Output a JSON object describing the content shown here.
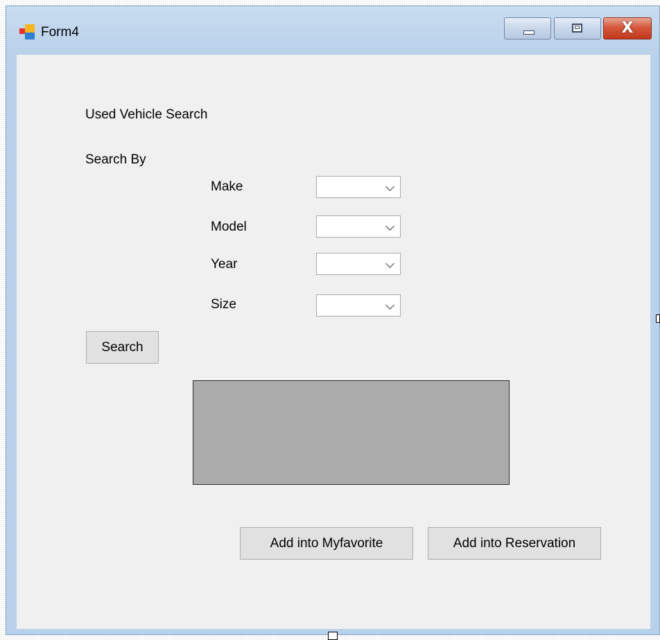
{
  "window": {
    "title": "Form4",
    "close_symbol": "X",
    "controls": {
      "minimize": "minimize-icon",
      "maximize": "maximize-icon",
      "close": "close-icon"
    }
  },
  "form": {
    "heading": "Used Vehicle Search",
    "search_by_label": "Search By",
    "fields": [
      {
        "label": "Make",
        "value": ""
      },
      {
        "label": "Model",
        "value": ""
      },
      {
        "label": "Year",
        "value": ""
      },
      {
        "label": "Size",
        "value": ""
      }
    ],
    "search_button": "Search",
    "favorite_button": "Add into Myfavorite",
    "reservation_button": "Add into Reservation"
  },
  "colors": {
    "client_background": "#f0f0f0",
    "picture_box": "#ababab",
    "button_face": "#e1e1e1"
  }
}
